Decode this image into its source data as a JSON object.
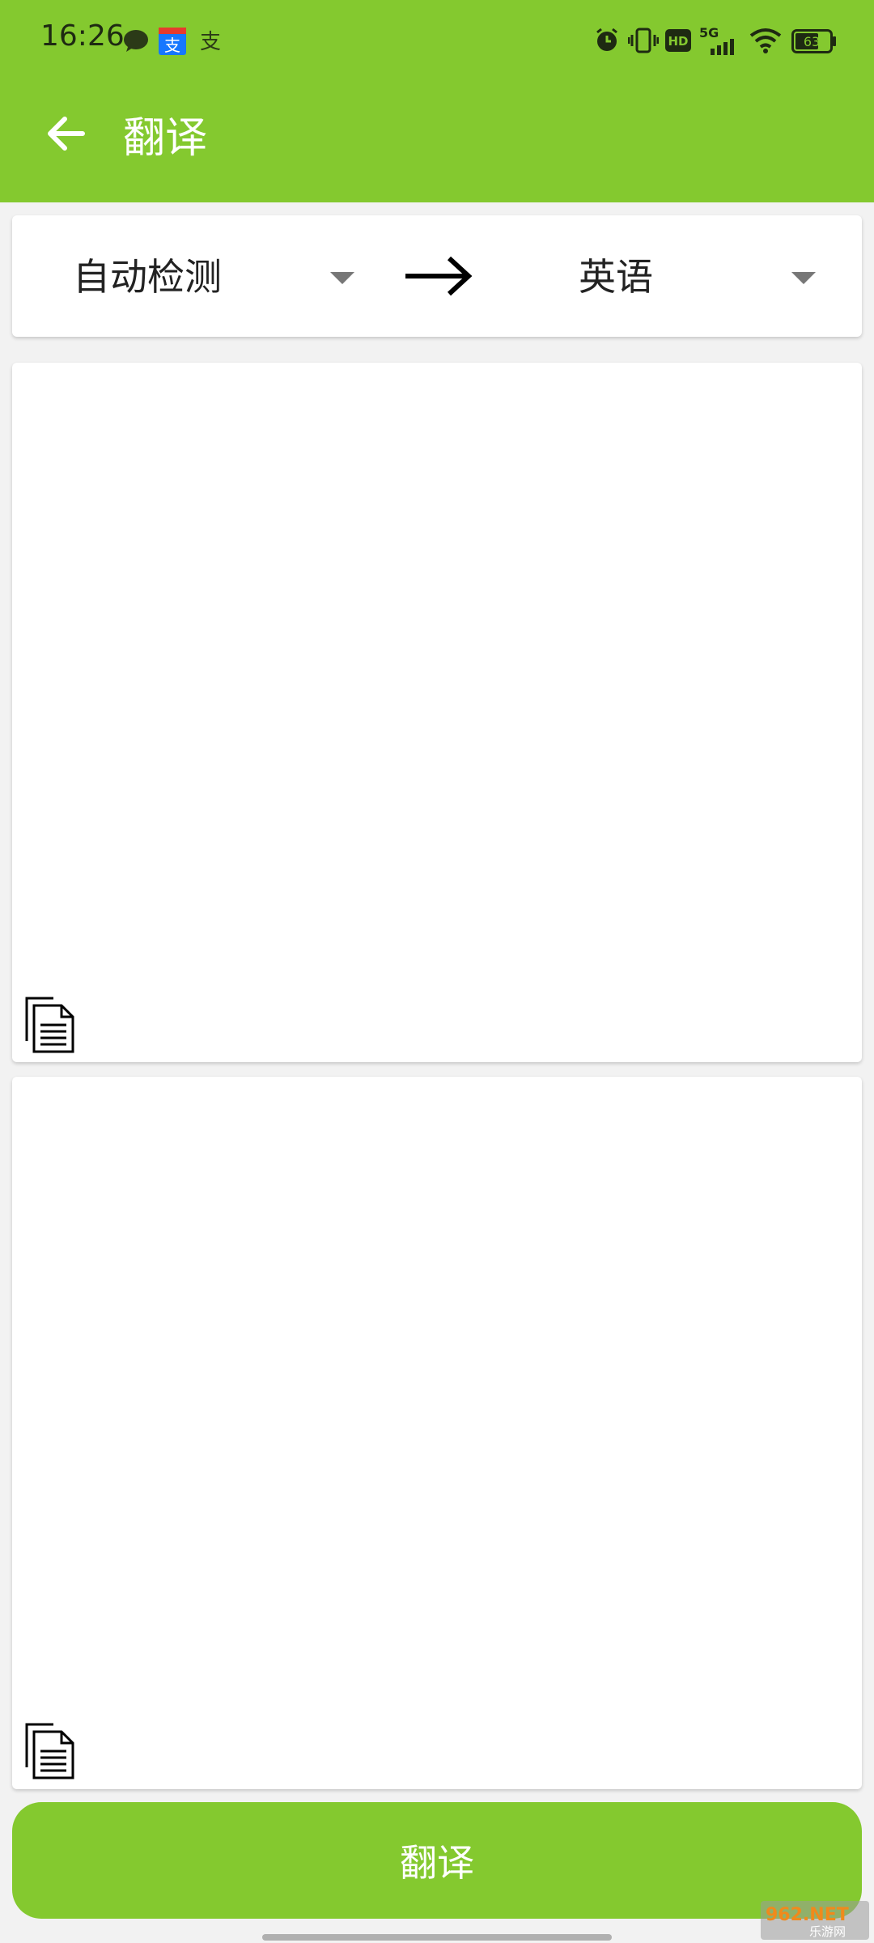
{
  "status_bar": {
    "time": "16:26",
    "battery": "63",
    "network": "5G",
    "hd_label": "HD",
    "notification_icons": [
      "wechat-icon",
      "alipay-icon",
      "alipay-text-icon"
    ],
    "system_icons": [
      "alarm-icon",
      "vibrate-icon",
      "hd-icon",
      "signal-icon",
      "wifi-icon",
      "battery-icon"
    ]
  },
  "toolbar": {
    "title": "翻译",
    "back_icon": "arrow-left-icon"
  },
  "language_bar": {
    "source_language": "自动检测",
    "target_language": "英语",
    "swap_icon": "arrow-right-icon"
  },
  "input_panel": {
    "value": "",
    "copy_icon": "copy-document-icon"
  },
  "output_panel": {
    "value": "",
    "copy_icon": "copy-document-icon"
  },
  "translate_button": {
    "label": "翻译"
  },
  "watermark": {
    "text": "962.NET",
    "subtext": "乐游网"
  },
  "colors": {
    "accent": "#84c92f",
    "background": "#f2f2f2",
    "card": "#ffffff"
  }
}
